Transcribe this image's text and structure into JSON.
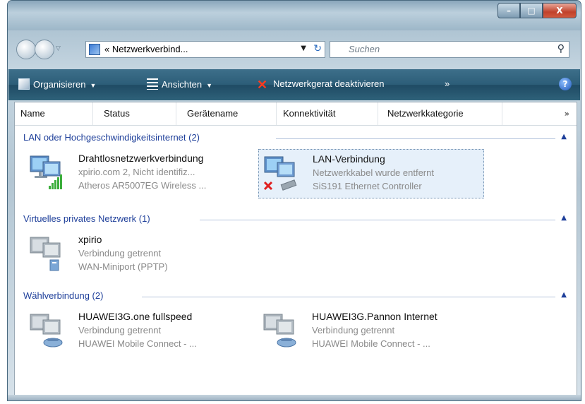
{
  "window": {
    "controls": {
      "minimize": "–",
      "maximize": "□",
      "close": "X"
    }
  },
  "address": {
    "path": "« Netzwerkverbind...",
    "search_placeholder": "Suchen"
  },
  "toolbar": {
    "organize": "Organisieren",
    "views": "Ansichten",
    "disable": "Netzwerkgerat deaktivieren",
    "more": "»",
    "help": "?"
  },
  "columns": [
    "Name",
    "Status",
    "Gerätename",
    "Konnektivität",
    "Netzwerkkategorie"
  ],
  "columns_more": "»",
  "groups": [
    {
      "title": "LAN oder Hochgeschwindigkeitsinternet (2)",
      "items": [
        {
          "name": "Drahtlosnetzwerkverbindung",
          "status": "xpirio.com  2, Nicht identifiz...",
          "device": "Atheros AR5007EG Wireless ...",
          "icon": "wireless-monitor-icon"
        },
        {
          "name": "LAN-Verbindung",
          "status": "Netzwerkkabel wurde entfernt",
          "device": "SiS191 Ethernet Controller",
          "icon": "lan-disconnected-icon"
        }
      ]
    },
    {
      "title": "Virtuelles privates Netzwerk (1)",
      "items": [
        {
          "name": "xpirio",
          "status": "Verbindung getrennt",
          "device": "WAN-Miniport (PPTP)",
          "icon": "vpn-icon"
        }
      ]
    },
    {
      "title": "Wählverbindung (2)",
      "items": [
        {
          "name": "HUAWEI3G.one fullspeed",
          "status": "Verbindung getrennt",
          "device": "HUAWEI Mobile Connect - ...",
          "icon": "dialup-modem-icon"
        },
        {
          "name": "HUAWEI3G.Pannon Internet",
          "status": "Verbindung getrennt",
          "device": "HUAWEI Mobile Connect - ...",
          "icon": "dialup-modem-icon"
        }
      ]
    }
  ],
  "colors": {
    "accent": "#2c5d78",
    "group_header": "#1e3f9a",
    "subtext": "#8a8a8a"
  }
}
